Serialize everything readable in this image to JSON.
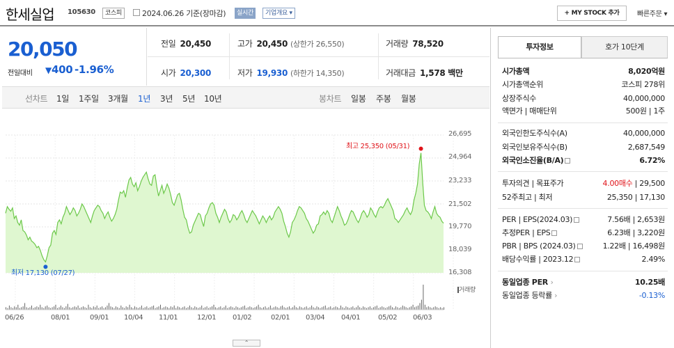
{
  "header": {
    "title": "한세실업",
    "code": "105630",
    "market": "코스피",
    "date": "2024.06.26",
    "basis": "기준(장마감)",
    "realtime": "실시간",
    "overview": "기업개요",
    "my_stock": "+ MY STOCK 추가",
    "quick_order": "빠른주문"
  },
  "price": {
    "current": "20,050",
    "change_label": "전일대비",
    "change_value": "400",
    "change_pct": "-1.96%"
  },
  "stats": {
    "prev_label": "전일",
    "prev_value": "20,450",
    "high_label": "고가",
    "high_value": "20,450",
    "high_sub": "(상한가 26,550)",
    "volume_label": "거래량",
    "volume_value": "78,520",
    "open_label": "시가",
    "open_value": "20,300",
    "low_label": "저가",
    "low_value": "19,930",
    "low_sub": "(하한가 14,350)",
    "amount_label": "거래대금",
    "amount_value": "1,578 백만"
  },
  "periods": {
    "line_chart": "선차트",
    "p1": "1일",
    "p2": "1주일",
    "p3": "3개월",
    "p4": "1년",
    "p5": "3년",
    "p6": "5년",
    "p7": "10년",
    "candle_chart": "봉차트",
    "daily": "일봉",
    "weekly": "주봉",
    "monthly": "월봉"
  },
  "chart_data": {
    "type": "area",
    "x_ticks": [
      "06/26",
      "08/01",
      "09/01",
      "10/04",
      "11/01",
      "12/01",
      "01/02",
      "02/01",
      "03/04",
      "04/01",
      "05/02",
      "06/03"
    ],
    "y_ticks": [
      "26,695",
      "24,964",
      "23,233",
      "21,502",
      "19,770",
      "18,039",
      "16,308"
    ],
    "ylim": [
      16308,
      26695
    ],
    "high_annotation": "최고 25,350 (05/31)",
    "low_annotation": "최저 17,130 (07/27)",
    "volume_label": "거래량",
    "price_series": [
      20800,
      21300,
      21100,
      20950,
      21200,
      20400,
      20600,
      20100,
      19900,
      20300,
      19500,
      19400,
      19150,
      18800,
      19000,
      18700,
      18600,
      18450,
      18200,
      18300,
      18000,
      17600,
      17300,
      17130,
      17600,
      18200,
      18400,
      19300,
      19500,
      19200,
      20100,
      20300,
      20000,
      20500,
      20800,
      21300,
      21000,
      20700,
      20900,
      21200,
      21000,
      20600,
      20800,
      21100,
      21500,
      21300,
      21000,
      20700,
      20400,
      20100,
      20600,
      21000,
      21200,
      21400,
      21300,
      21000,
      20800,
      20400,
      20700,
      20900,
      20500,
      20200,
      20400,
      20700,
      21100,
      21800,
      22400,
      22300,
      22500,
      22000,
      22700,
      23300,
      23500,
      23000,
      22800,
      23100,
      22500,
      22800,
      23200,
      23500,
      23700,
      23900,
      23400,
      23000,
      22900,
      23600,
      23700,
      22800,
      22100,
      22500,
      22900,
      22300,
      22600,
      23000,
      22700,
      22200,
      21600,
      21400,
      21800,
      22200,
      22300,
      21800,
      21100,
      20500,
      20300,
      19700,
      19300,
      19400,
      19900,
      20200,
      20500,
      20800,
      20700,
      20200,
      19800,
      20600,
      20800,
      21200,
      21500,
      21600,
      21400,
      20800,
      20500,
      20100,
      20500,
      20800,
      21100,
      20900,
      20400,
      20100,
      20300,
      20700,
      20600,
      20300,
      20500,
      20800,
      21000,
      20700,
      20300,
      20100,
      20400,
      20700,
      21000,
      20800,
      20600,
      20300,
      20000,
      20300,
      20600,
      20400,
      20100,
      20400,
      20600,
      20300,
      20500,
      20900,
      21100,
      21300,
      21100,
      20800,
      20200,
      19800,
      19300,
      19000,
      19400,
      20100,
      20300,
      20600,
      21000,
      21300,
      21200,
      21000,
      20800,
      20400,
      20200,
      19900,
      19600,
      19300,
      19500,
      19900,
      20000,
      20600,
      20700,
      20900,
      20700,
      21000,
      20800,
      20300,
      20100,
      20500,
      20900,
      21300,
      21000,
      20600,
      20300,
      19900,
      20000,
      20300,
      20700,
      21000,
      20900,
      20600,
      20300,
      20100,
      20400,
      20800,
      21000,
      20800,
      20500,
      20700,
      21200,
      21000,
      20700,
      20500,
      20900,
      21200,
      21300,
      21200,
      21400,
      21700,
      21900,
      21600,
      21300,
      21000,
      20400,
      20300,
      20100,
      20300,
      20500,
      20700,
      21000,
      21200,
      20900,
      20700,
      21000,
      21800,
      22300,
      23000,
      24500,
      25350,
      23200,
      21400,
      21000,
      20900,
      20700,
      20400,
      20900,
      21300,
      20800,
      20600,
      20500,
      20200,
      20050
    ],
    "volume_series": [
      3,
      2,
      5,
      3,
      2,
      4,
      3,
      6,
      2,
      3,
      4,
      8,
      3,
      2,
      3,
      5,
      2,
      3,
      4,
      3,
      6,
      3,
      2,
      4,
      5,
      3,
      2,
      3,
      4,
      6,
      2,
      3,
      5,
      3,
      2,
      4,
      7,
      3,
      2,
      3,
      4,
      3,
      5,
      2,
      3,
      4,
      3,
      2,
      6,
      3,
      2,
      4,
      3,
      5,
      2,
      3,
      4,
      2,
      3,
      5,
      8,
      4,
      3,
      2,
      4,
      3,
      2,
      5,
      3,
      2,
      4,
      3,
      6,
      3,
      2,
      4,
      3,
      2,
      3,
      5,
      2,
      3,
      4,
      2,
      3,
      4,
      5,
      2,
      3,
      4,
      6,
      2,
      3,
      4,
      3,
      2,
      4,
      3,
      5,
      2,
      4,
      3,
      2,
      3,
      4,
      2,
      3,
      5,
      3,
      2,
      4,
      3,
      2,
      3,
      5,
      2,
      3,
      4,
      2,
      3,
      4,
      6,
      3,
      2,
      3,
      4,
      2,
      3,
      5,
      2,
      3,
      4,
      3,
      2,
      4,
      3,
      2,
      3,
      4,
      5,
      2,
      3,
      4,
      3,
      2,
      3,
      4,
      6,
      3,
      2,
      3,
      4,
      2,
      3,
      5,
      2,
      3,
      4,
      3,
      2,
      4,
      5,
      3,
      2,
      3,
      4,
      2,
      3,
      5,
      3,
      2,
      4,
      3,
      2,
      3,
      4,
      2,
      3,
      5,
      3,
      2,
      4,
      3,
      2,
      3,
      4,
      5,
      2,
      3,
      4,
      2,
      3,
      4,
      3,
      2,
      5,
      3,
      2,
      4,
      3,
      2,
      3,
      4,
      2,
      3,
      5,
      3,
      2,
      4,
      3,
      2,
      3,
      4,
      2,
      3,
      4,
      5,
      2,
      3,
      4,
      3,
      2,
      3,
      4,
      5,
      3,
      2,
      4,
      3,
      2,
      3,
      5,
      4,
      3,
      2,
      3,
      4,
      6,
      3,
      4,
      5,
      8,
      12,
      30,
      6,
      3,
      4,
      3,
      2,
      3,
      4,
      3,
      2,
      3,
      2,
      3
    ]
  },
  "panel": {
    "tab_invest": "투자정보",
    "tab_hoga": "호가 10단계",
    "mkt_cap_label": "시가총액",
    "mkt_cap_value": "8,020억원",
    "mkt_rank_label": "시가총액순위",
    "mkt_rank_value": "코스피 278위",
    "shares_label": "상장주식수",
    "shares_value": "40,000,000",
    "par_label": "액면가 | 매매단위",
    "par_value": "500원 | 1주",
    "foreign_limit_label": "외국인한도주식수(A)",
    "foreign_limit_value": "40,000,000",
    "foreign_hold_label": "외국인보유주식수(B)",
    "foreign_hold_value": "2,687,549",
    "foreign_ratio_label": "외국인소진율(B/A)",
    "foreign_ratio_value": "6.72%",
    "opinion_label": "투자의견 | 목표주가",
    "opinion_value": "4.00매수",
    "target_value": "29,500",
    "w52_label": "52주최고 | 최저",
    "w52_value": "25,350 | 17,130",
    "per_label": "PER | EPS(2024.03)",
    "per_value": "7.56배 | 2,653원",
    "est_per_label": "추정PER | EPS",
    "est_per_value": "6.23배 | 3,220원",
    "pbr_label": "PBR | BPS (2024.03)",
    "pbr_value": "1.22배 | 16,498원",
    "div_label": "배당수익률 | 2023.12",
    "div_value": "2.49%",
    "ind_per_label": "동일업종 PER",
    "ind_per_value": "10.25배",
    "ind_chg_label": "동일업종 등락률",
    "ind_chg_value": "-0.13%"
  }
}
